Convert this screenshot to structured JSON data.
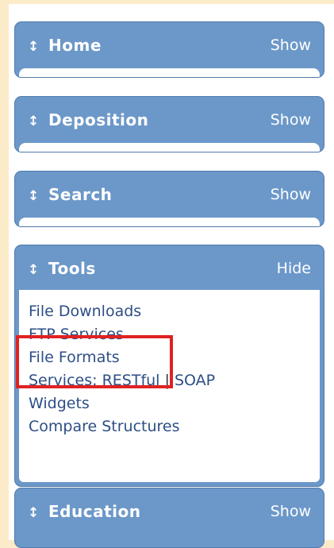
{
  "sidebar": {
    "panels": [
      {
        "title": "Home",
        "toggle": "Show"
      },
      {
        "title": "Deposition",
        "toggle": "Show"
      },
      {
        "title": "Search",
        "toggle": "Show"
      },
      {
        "title": "Tools",
        "toggle": "Hide"
      },
      {
        "title": "Education",
        "toggle": "Show"
      }
    ],
    "tools_links": {
      "file_downloads": "File Downloads",
      "ftp_services": "FTP Services",
      "file_formats": "File Formats",
      "services_prefix": "Services:",
      "restful": "RESTful",
      "separator": "|",
      "soap": "SOAP",
      "widgets": "Widgets",
      "compare_structures": "Compare Structures"
    }
  },
  "colors": {
    "page_background": "#fcebc9",
    "panel_header": "#6c98c9",
    "link": "#2d4e85",
    "highlight": "#e02222"
  },
  "icons": {
    "panel_arrow": "up-down-arrow-icon"
  }
}
